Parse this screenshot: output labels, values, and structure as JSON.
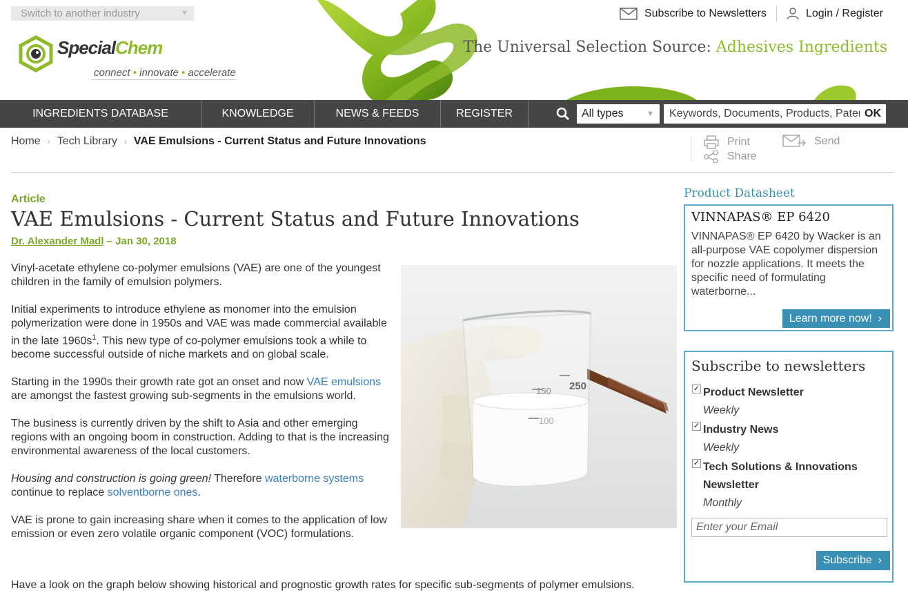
{
  "header": {
    "industry_switch": "Switch to another industry",
    "logo": {
      "special": "Special",
      "chem": "Chem",
      "tag": [
        "connect",
        "innovate",
        "accelerate"
      ]
    },
    "subscribe_link": "Subscribe to Newsletters",
    "login_link": "Login / Register",
    "tagline_prefix": "The Universal Selection Source:",
    "tagline_accent": "Adhesives Ingredients"
  },
  "nav": {
    "items": [
      "INGREDIENTS DATABASE",
      "KNOWLEDGE",
      "NEWS & FEEDS",
      "REGISTER"
    ],
    "type_select": "All types",
    "search_placeholder": "Keywords, Documents, Products, Patents",
    "ok": "OK"
  },
  "breadcrumb": {
    "home": "Home",
    "library": "Tech Library",
    "current": "VAE Emulsions - Current Status and Future Innovations"
  },
  "tools": {
    "print": "Print",
    "send": "Send",
    "share": "Share"
  },
  "article": {
    "label": "Article",
    "title": "VAE Emulsions - Current Status and Future Innovations",
    "author": "Dr. Alexander Madl",
    "date": " – Jan 30, 2018",
    "p1": "Vinyl-acetate ethylene co-polymer emulsions (VAE) are one of the youngest children in the family of emulsion polymers.",
    "p2_a": "Initial experiments to introduce ethylene as monomer into the emulsion polymerization were done in 1950s and VAE was made commercial available in the late 1960s",
    "p2_sup": "1",
    "p2_b": ". This new type of co-polymer emulsions took a while to become successful outside of niche markets and on global scale.",
    "p3_a": "Starting in the 1990s their growth rate got an onset and now ",
    "p3_link": "VAE emulsions",
    "p3_b": " are amongst the fastest growing sub-segments in the emulsions world.",
    "p4": "The business is currently driven by the shift to Asia and other emerging regions with an ongoing boom in construction. Adding to that is the increasing environmental awareness of the local customers.",
    "p5_em": "Housing and construction is going green!",
    "p5_a": " Therefore ",
    "p5_link1": "waterborne systems",
    "p5_b": " continue to replace ",
    "p5_link2": "solventborne ones",
    "p5_c": ".",
    "p6": "VAE is prone to gain increasing share when it comes to the application of low emission or even zero volatile organic component (VOC) formulations.",
    "p7": "Have a look on the graph below showing historical and prognostic growth rates for specific sub-segments of polymer emulsions.",
    "beaker_marks": [
      "250",
      "150",
      "100"
    ]
  },
  "sidebar": {
    "datasheet_label": "Product Datasheet",
    "datasheet_title": "VINNAPAS® EP 6420",
    "datasheet_desc": "VINNAPAS® EP 6420 by Wacker is an all-purpose VAE copolymer dispersion for nozzle applications. It meets the specific need of formulating waterborne...",
    "learn_more": "Learn more now!",
    "newsletter_title": "Subscribe to newsletters",
    "newsletters": [
      {
        "name": "Product Newsletter",
        "freq": "Weekly"
      },
      {
        "name": "Industry News",
        "freq": "Weekly"
      },
      {
        "name": "Tech Solutions & Innovations Newsletter",
        "freq": "Monthly"
      }
    ],
    "email_placeholder": "Enter your Email",
    "subscribe_btn": "Subscribe"
  },
  "colors": {
    "accent_green": "#8dbb2a",
    "accent_blue": "#3a8fb4",
    "nav_bg": "#454545"
  }
}
